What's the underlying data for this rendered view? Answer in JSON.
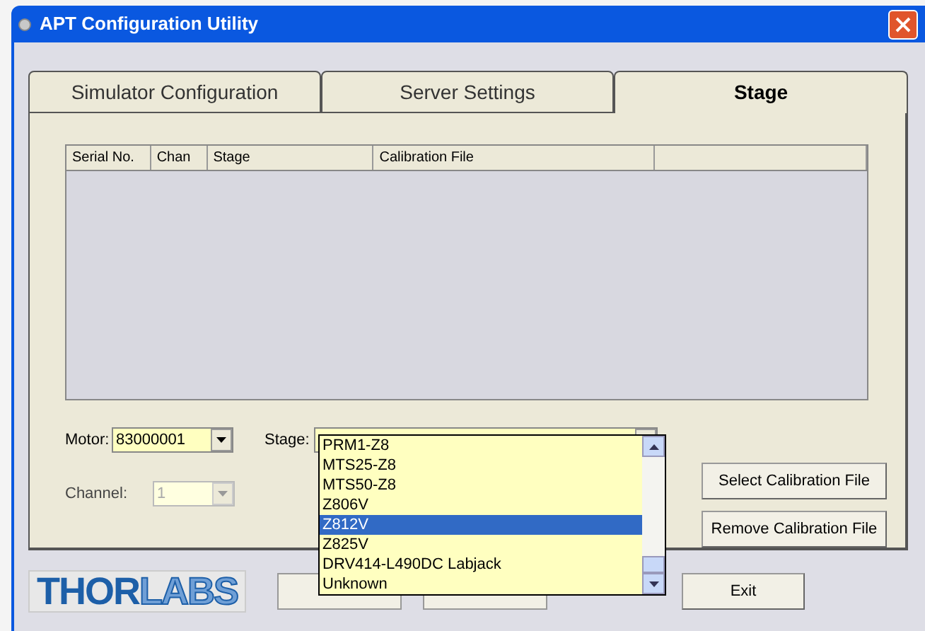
{
  "window": {
    "title": "APT Configuration Utility"
  },
  "tabs": [
    {
      "label": "Simulator Configuration",
      "selected": false
    },
    {
      "label": "Server Settings",
      "selected": false
    },
    {
      "label": "Stage",
      "selected": true
    }
  ],
  "table": {
    "columns": [
      "Serial No.",
      "Chan",
      "Stage",
      "Calibration File"
    ]
  },
  "motor": {
    "label": "Motor:",
    "value": "83000001"
  },
  "channel": {
    "label": "Channel:",
    "value": "1",
    "disabled": true
  },
  "stage": {
    "label": "Stage:",
    "options": [
      {
        "label": "PRM1-Z8",
        "selected": false
      },
      {
        "label": "MTS25-Z8",
        "selected": false
      },
      {
        "label": "MTS50-Z8",
        "selected": false
      },
      {
        "label": "Z806V",
        "selected": false
      },
      {
        "label": "Z812V",
        "selected": true
      },
      {
        "label": "Z825V",
        "selected": false
      },
      {
        "label": "DRV414-L490DC Labjack",
        "selected": false
      },
      {
        "label": "Unknown",
        "selected": false
      }
    ]
  },
  "side_buttons": [
    "Select Calibration File",
    "Remove Calibration File"
  ],
  "logo": {
    "parts": [
      "THOR",
      "LABS"
    ]
  },
  "exit_button": "Exit"
}
